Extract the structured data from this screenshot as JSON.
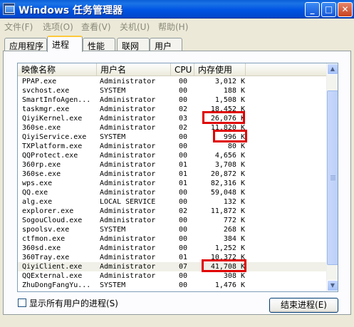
{
  "window": {
    "title": "Windows 任务管理器",
    "btn_min": "_",
    "btn_max": "□",
    "btn_close": "✕"
  },
  "menu": [
    "文件(F)",
    "选项(O)",
    "查看(V)",
    "关机(U)",
    "帮助(H)"
  ],
  "tabs": [
    "应用程序",
    "进程",
    "性能",
    "联网",
    "用户"
  ],
  "active_tab": "进程",
  "columns": [
    "映像名称",
    "用户名",
    "CPU",
    "内存使用"
  ],
  "processes": [
    {
      "name": "PPAP.exe",
      "user": "Administrator",
      "cpu": "00",
      "mem": "3,012 K"
    },
    {
      "name": "svchost.exe",
      "user": "SYSTEM",
      "cpu": "00",
      "mem": "188 K"
    },
    {
      "name": "SmartInfoAgen...",
      "user": "Administrator",
      "cpu": "00",
      "mem": "1,508 K"
    },
    {
      "name": "taskmgr.exe",
      "user": "Administrator",
      "cpu": "02",
      "mem": "18,452 K"
    },
    {
      "name": "QiyiKernel.exe",
      "user": "Administrator",
      "cpu": "03",
      "mem": "26,076 K"
    },
    {
      "name": "360se.exe",
      "user": "Administrator",
      "cpu": "02",
      "mem": "11,820 K"
    },
    {
      "name": "QiyiService.exe",
      "user": "SYSTEM",
      "cpu": "00",
      "mem": "996 K"
    },
    {
      "name": "TXPlatform.exe",
      "user": "Administrator",
      "cpu": "00",
      "mem": "80 K"
    },
    {
      "name": "QQProtect.exe",
      "user": "Administrator",
      "cpu": "00",
      "mem": "4,656 K"
    },
    {
      "name": "360rp.exe",
      "user": "Administrator",
      "cpu": "01",
      "mem": "3,708 K"
    },
    {
      "name": "360se.exe",
      "user": "Administrator",
      "cpu": "01",
      "mem": "20,872 K"
    },
    {
      "name": "wps.exe",
      "user": "Administrator",
      "cpu": "01",
      "mem": "82,316 K"
    },
    {
      "name": "QQ.exe",
      "user": "Administrator",
      "cpu": "00",
      "mem": "59,048 K"
    },
    {
      "name": "alg.exe",
      "user": "LOCAL SERVICE",
      "cpu": "00",
      "mem": "132 K"
    },
    {
      "name": "explorer.exe",
      "user": "Administrator",
      "cpu": "02",
      "mem": "11,872 K"
    },
    {
      "name": "SogouCloud.exe",
      "user": "Administrator",
      "cpu": "00",
      "mem": "772 K"
    },
    {
      "name": "spoolsv.exe",
      "user": "SYSTEM",
      "cpu": "00",
      "mem": "268 K"
    },
    {
      "name": "ctfmon.exe",
      "user": "Administrator",
      "cpu": "00",
      "mem": "384 K"
    },
    {
      "name": "360sd.exe",
      "user": "Administrator",
      "cpu": "00",
      "mem": "1,252 K"
    },
    {
      "name": "360Tray.exe",
      "user": "Administrator",
      "cpu": "01",
      "mem": "10,372 K"
    },
    {
      "name": "QiyiClient.exe",
      "user": "Administrator",
      "cpu": "07",
      "mem": "41,708 K"
    },
    {
      "name": "QQExternal.exe",
      "user": "Administrator",
      "cpu": "00",
      "mem": "308 K"
    },
    {
      "name": "ZhuDongFangYu...",
      "user": "SYSTEM",
      "cpu": "00",
      "mem": "1,476 K"
    }
  ],
  "selected_row": 20,
  "highlight_color": "#E00000",
  "show_all_users_label": "显示所有用户的进程(S)",
  "end_process_label": "结束进程(E)"
}
